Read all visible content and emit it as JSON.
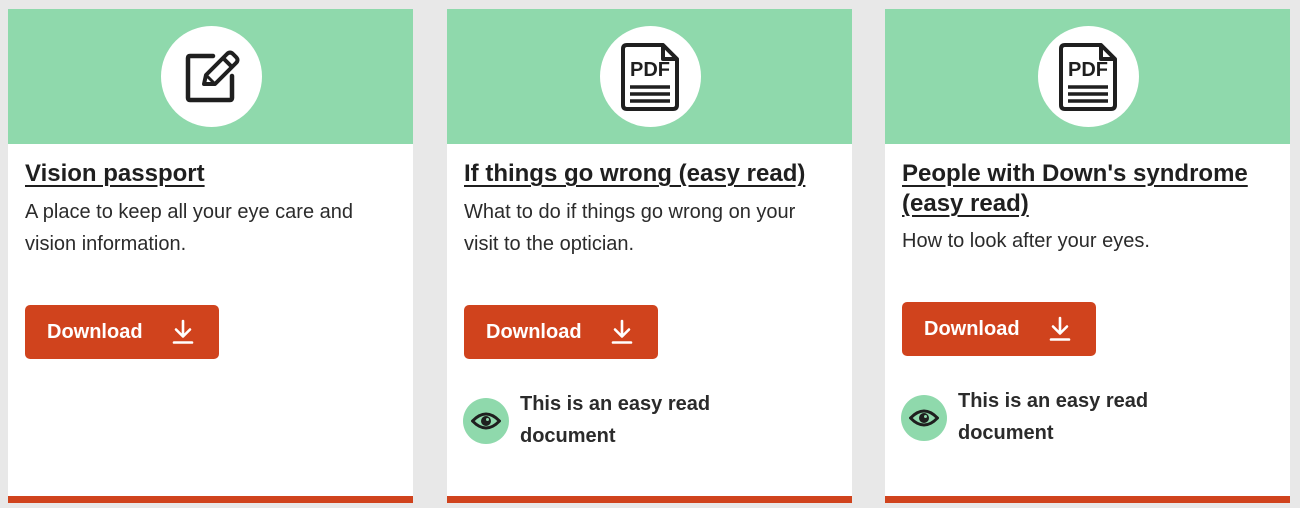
{
  "colors": {
    "header_bg": "#8fd9ac",
    "accent": "#d0431d",
    "card_bg": "#ffffff",
    "page_bg": "#e8e8e8",
    "text": "#1f1f1f"
  },
  "cards": [
    {
      "icon": "edit-document-icon",
      "title": "Vision passport",
      "description": "A place to keep all your eye care and vision information.",
      "button_label": "Download",
      "easy_read": false
    },
    {
      "icon": "pdf-file-icon",
      "icon_text": "PDF",
      "title": "If things go wrong (easy read)",
      "description": "What to do if things go wrong on your visit to the optician.",
      "button_label": "Download",
      "easy_read": true,
      "easy_read_text": "This is an easy read document"
    },
    {
      "icon": "pdf-file-icon",
      "icon_text": "PDF",
      "title": "People with Down's syndrome (easy read)",
      "description": "How to look after your eyes.",
      "button_label": "Download",
      "easy_read": true,
      "easy_read_text": "This is an easy read document"
    }
  ]
}
